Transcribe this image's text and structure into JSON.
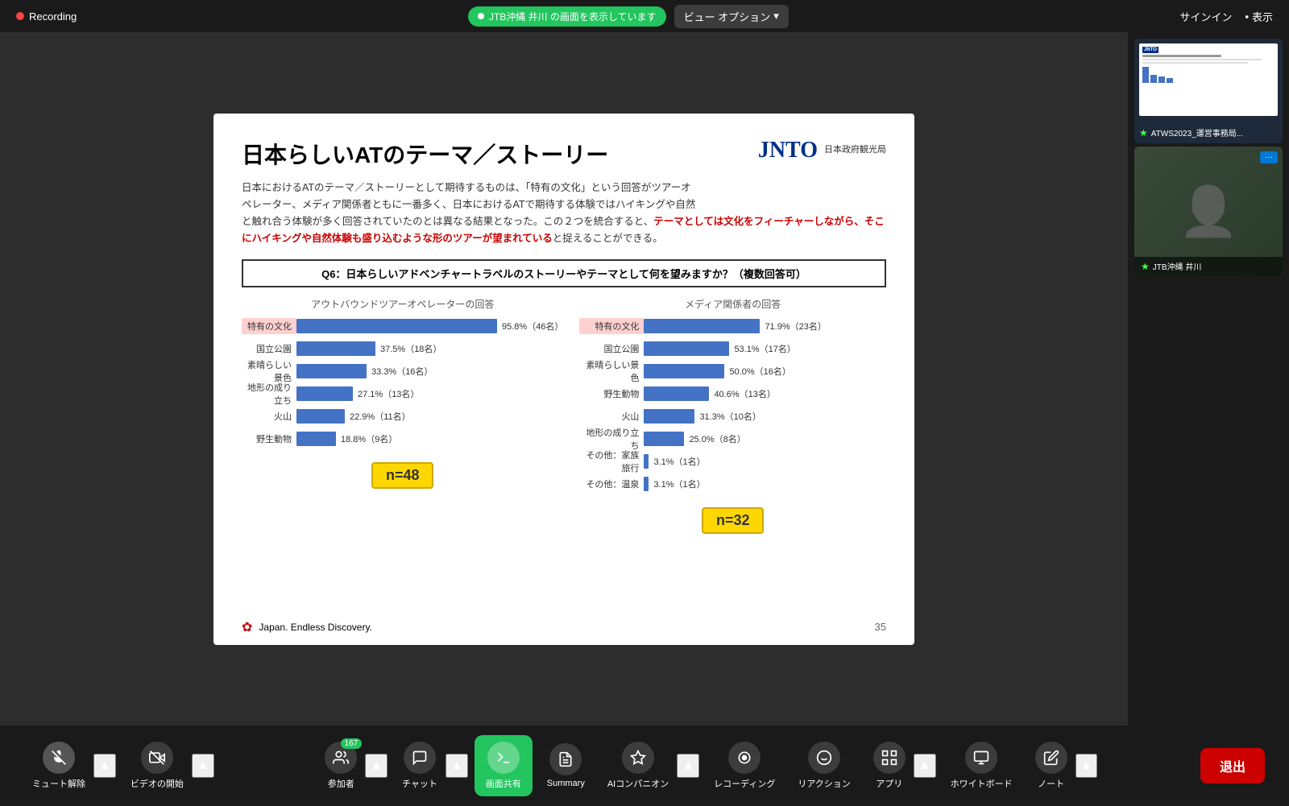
{
  "topBar": {
    "recording": "Recording",
    "screenShare": "JTB沖縄 井川 の画面を表示しています",
    "viewOptions": "ビュー オプション",
    "signIn": "サインイン",
    "display": "表示"
  },
  "slide": {
    "title": "日本らしいATのテーマ／ストーリー",
    "description1": "日本におけるATのテーマ／ストーリーとして期待するものは、「特有の文化」という回答がツアーオ",
    "description2": "ペレーター、メディア関係者ともに一番多く、日本におけるATで期待する体験ではハイキングや自然",
    "description3": "と触れ合う体験が多く回答されていたのとは異なる結果となった。この２つを統合すると、",
    "descriptionRed": "テーマとしては文化をフィーチャーしながら、そこにハイキングや自然体験も盛り込むような形のツアーが望まれている",
    "description4": "と捉えることができる。",
    "question": "Q6：日本らしいアドベンチャートラベルのストーリーやテーマとして何を望みますか？（複数回答可）",
    "leftChartTitle": "アウトバウンドツアーオペレーターの回答",
    "rightChartTitle": "メディア関係者の回答",
    "leftBars": [
      {
        "label": "特有の文化",
        "percent": 95.8,
        "value": "95.8%（46名）",
        "maxWidth": 260,
        "highlighted": true
      },
      {
        "label": "国立公園",
        "percent": 37.5,
        "value": "37.5%（18名）",
        "maxWidth": 260,
        "highlighted": false
      },
      {
        "label": "素晴らしい景色",
        "percent": 33.3,
        "value": "33.3%（16名）",
        "maxWidth": 260,
        "highlighted": false
      },
      {
        "label": "地形の成り立ち",
        "percent": 27.1,
        "value": "27.1%（13名）",
        "maxWidth": 260,
        "highlighted": false
      },
      {
        "label": "火山",
        "percent": 22.9,
        "value": "22.9%（11名）",
        "maxWidth": 260,
        "highlighted": false
      },
      {
        "label": "野生動物",
        "percent": 18.8,
        "value": "18.8%（9名）",
        "maxWidth": 260,
        "highlighted": false
      }
    ],
    "rightBars": [
      {
        "label": "特有の文化",
        "percent": 71.9,
        "value": "71.9%（23名）",
        "maxWidth": 200,
        "highlighted": true
      },
      {
        "label": "国立公園",
        "percent": 53.1,
        "value": "53.1%（17名）",
        "maxWidth": 200,
        "highlighted": false
      },
      {
        "label": "素晴らしい景色",
        "percent": 50.0,
        "value": "50.0%（16名）",
        "maxWidth": 200,
        "highlighted": false
      },
      {
        "label": "野生動物",
        "percent": 40.6,
        "value": "40.6%（13名）",
        "maxWidth": 200,
        "highlighted": false
      },
      {
        "label": "火山",
        "percent": 31.3,
        "value": "31.3%（10名）",
        "maxWidth": 200,
        "highlighted": false
      },
      {
        "label": "地形の成り立ち",
        "percent": 25.0,
        "value": "25.0%（8名）",
        "maxWidth": 200,
        "highlighted": false
      },
      {
        "label": "その他：家族旅行",
        "percent": 3.1,
        "value": "3.1%（1名）",
        "maxWidth": 200,
        "highlighted": false
      },
      {
        "label": "その他：温泉",
        "percent": 3.1,
        "value": "3.1%（1名）",
        "maxWidth": 200,
        "highlighted": false
      }
    ],
    "leftN": "n=48",
    "rightN": "n=32",
    "pageNumber": "35",
    "japanTagline": "Japan. Endless Discovery."
  },
  "sidebar": {
    "thumb1Label": "ATWS2023_運営事務局...",
    "thumb2Label": "JTB沖縄 井川"
  },
  "toolbar": {
    "mic": "ミュート解除",
    "video": "ビデオの開始",
    "participants": "参加者",
    "participantCount": "167",
    "chat": "チャット",
    "share": "画面共有",
    "summary": "Summary",
    "ai": "AIコンパニオン",
    "recording": "レコーディング",
    "reaction": "リアクション",
    "apps": "アプリ",
    "whiteboard": "ホワイトボード",
    "notes": "ノート",
    "leave": "退出"
  }
}
